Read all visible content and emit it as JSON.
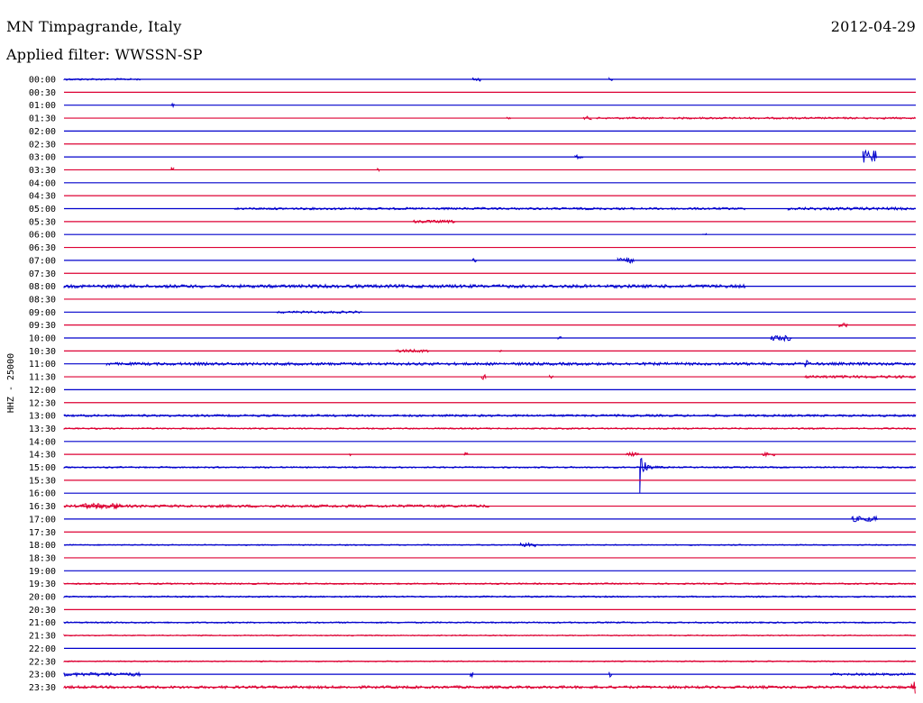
{
  "header": {
    "title": "MN Timpagrande, Italy",
    "date": "2012-04-29",
    "filter": "Applied filter: WWSSN-SP"
  },
  "chart_data": {
    "type": "line",
    "ylabel": "HHZ - 25000",
    "colors": {
      "even": "#0000cc",
      "odd": "#dd0033"
    },
    "x_window_minutes": [
      0,
      30
    ],
    "rows": [
      {
        "label": "00:00",
        "events": [
          {
            "x": 0.0,
            "w": 0.09,
            "a": 1.0
          },
          {
            "x": 0.48,
            "w": 0.01,
            "a": 2
          },
          {
            "x": 0.64,
            "w": 0.005,
            "a": 2
          }
        ]
      },
      {
        "label": "00:30",
        "events": []
      },
      {
        "label": "01:00",
        "events": [
          {
            "x": 0.126,
            "w": 0.004,
            "a": 2
          }
        ]
      },
      {
        "label": "01:30",
        "events": [
          {
            "x": 0.52,
            "w": 0.005,
            "a": 1.5
          },
          {
            "x": 0.61,
            "w": 0.01,
            "a": 2
          },
          {
            "x": 0.625,
            "w": 0.375,
            "a": 1.0
          }
        ]
      },
      {
        "label": "02:00",
        "events": []
      },
      {
        "label": "02:30",
        "events": []
      },
      {
        "label": "03:00",
        "events": [
          {
            "x": 0.6,
            "w": 0.01,
            "a": 2
          },
          {
            "x": 0.938,
            "w": 0.016,
            "a": 7
          }
        ]
      },
      {
        "label": "03:30",
        "events": [
          {
            "x": 0.126,
            "w": 0.004,
            "a": 3
          },
          {
            "x": 0.368,
            "w": 0.003,
            "a": 2
          }
        ]
      },
      {
        "label": "04:00",
        "events": []
      },
      {
        "label": "04:30",
        "events": []
      },
      {
        "label": "05:00",
        "events": [
          {
            "x": 0.2,
            "w": 0.6,
            "a": 1.2
          },
          {
            "x": 0.85,
            "w": 0.15,
            "a": 1.5
          }
        ]
      },
      {
        "label": "05:30",
        "events": [
          {
            "x": 0.41,
            "w": 0.05,
            "a": 1.5
          }
        ]
      },
      {
        "label": "06:00",
        "events": [
          {
            "x": 0.75,
            "w": 0.005,
            "a": 1.5
          }
        ]
      },
      {
        "label": "06:30",
        "events": []
      },
      {
        "label": "07:00",
        "events": [
          {
            "x": 0.65,
            "w": 0.02,
            "a": 3
          },
          {
            "x": 0.48,
            "w": 0.005,
            "a": 2
          }
        ]
      },
      {
        "label": "07:30",
        "events": []
      },
      {
        "label": "08:00",
        "events": [
          {
            "x": 0.0,
            "w": 0.8,
            "a": 1.8
          }
        ]
      },
      {
        "label": "08:30",
        "events": []
      },
      {
        "label": "09:00",
        "events": [
          {
            "x": 0.25,
            "w": 0.1,
            "a": 1.2
          }
        ]
      },
      {
        "label": "09:30",
        "events": [
          {
            "x": 0.91,
            "w": 0.01,
            "a": 2
          }
        ]
      },
      {
        "label": "10:00",
        "events": [
          {
            "x": 0.58,
            "w": 0.005,
            "a": 2.5
          },
          {
            "x": 0.83,
            "w": 0.025,
            "a": 3
          }
        ]
      },
      {
        "label": "10:30",
        "events": [
          {
            "x": 0.39,
            "w": 0.04,
            "a": 1.5
          },
          {
            "x": 0.51,
            "w": 0.005,
            "a": 1.5
          }
        ]
      },
      {
        "label": "11:00",
        "events": [
          {
            "x": 0.05,
            "w": 0.95,
            "a": 1.5
          },
          {
            "x": 0.87,
            "w": 0.005,
            "a": 4
          }
        ]
      },
      {
        "label": "11:30",
        "events": [
          {
            "x": 0.49,
            "w": 0.006,
            "a": 3
          },
          {
            "x": 0.57,
            "w": 0.005,
            "a": 2
          },
          {
            "x": 0.87,
            "w": 0.13,
            "a": 1.5
          }
        ]
      },
      {
        "label": "12:00",
        "events": []
      },
      {
        "label": "12:30",
        "events": []
      },
      {
        "label": "13:00",
        "events": [
          {
            "x": 0.0,
            "w": 1.0,
            "a": 1.2
          }
        ]
      },
      {
        "label": "13:30",
        "events": [
          {
            "x": 0.0,
            "w": 1.0,
            "a": 0.8
          }
        ]
      },
      {
        "label": "14:00",
        "events": []
      },
      {
        "label": "14:30",
        "events": [
          {
            "x": 0.335,
            "w": 0.004,
            "a": 2
          },
          {
            "x": 0.47,
            "w": 0.005,
            "a": 2
          },
          {
            "x": 0.66,
            "w": 0.015,
            "a": 2
          },
          {
            "x": 0.82,
            "w": 0.015,
            "a": 2
          }
        ]
      },
      {
        "label": "15:00",
        "events": [
          {
            "x": 0.676,
            "w": 0.03,
            "a": 34
          },
          {
            "x": 0.0,
            "w": 1.0,
            "a": 0.8
          }
        ]
      },
      {
        "label": "15:30",
        "events": []
      },
      {
        "label": "16:00",
        "events": []
      },
      {
        "label": "16:30",
        "events": [
          {
            "x": 0.0,
            "w": 0.5,
            "a": 1.5
          },
          {
            "x": 0.02,
            "w": 0.05,
            "a": 3
          }
        ]
      },
      {
        "label": "17:00",
        "events": [
          {
            "x": 0.925,
            "w": 0.03,
            "a": 3
          }
        ]
      },
      {
        "label": "17:30",
        "events": []
      },
      {
        "label": "18:00",
        "events": [
          {
            "x": 0.535,
            "w": 0.02,
            "a": 2
          },
          {
            "x": 0.0,
            "w": 1.0,
            "a": 0.6
          }
        ]
      },
      {
        "label": "18:30",
        "events": []
      },
      {
        "label": "19:00",
        "events": []
      },
      {
        "label": "19:30",
        "events": [
          {
            "x": 0.0,
            "w": 1.0,
            "a": 0.8
          }
        ]
      },
      {
        "label": "20:00",
        "events": [
          {
            "x": 0.0,
            "w": 1.0,
            "a": 0.8
          }
        ]
      },
      {
        "label": "20:30",
        "events": []
      },
      {
        "label": "21:00",
        "events": [
          {
            "x": 0.0,
            "w": 1.0,
            "a": 0.8
          }
        ]
      },
      {
        "label": "21:30",
        "events": [
          {
            "x": 0.0,
            "w": 1.0,
            "a": 0.6
          }
        ]
      },
      {
        "label": "22:00",
        "events": []
      },
      {
        "label": "22:30",
        "events": [
          {
            "x": 0.0,
            "w": 1.0,
            "a": 0.6
          }
        ]
      },
      {
        "label": "23:00",
        "events": [
          {
            "x": 0.0,
            "w": 0.09,
            "a": 2
          },
          {
            "x": 0.477,
            "w": 0.004,
            "a": 3
          },
          {
            "x": 0.64,
            "w": 0.004,
            "a": 3
          },
          {
            "x": 0.9,
            "w": 0.1,
            "a": 1.2
          }
        ]
      },
      {
        "label": "23:30",
        "events": [
          {
            "x": 0.0,
            "w": 1.0,
            "a": 1.5
          },
          {
            "x": 0.995,
            "w": 0.005,
            "a": 8
          }
        ]
      }
    ]
  }
}
